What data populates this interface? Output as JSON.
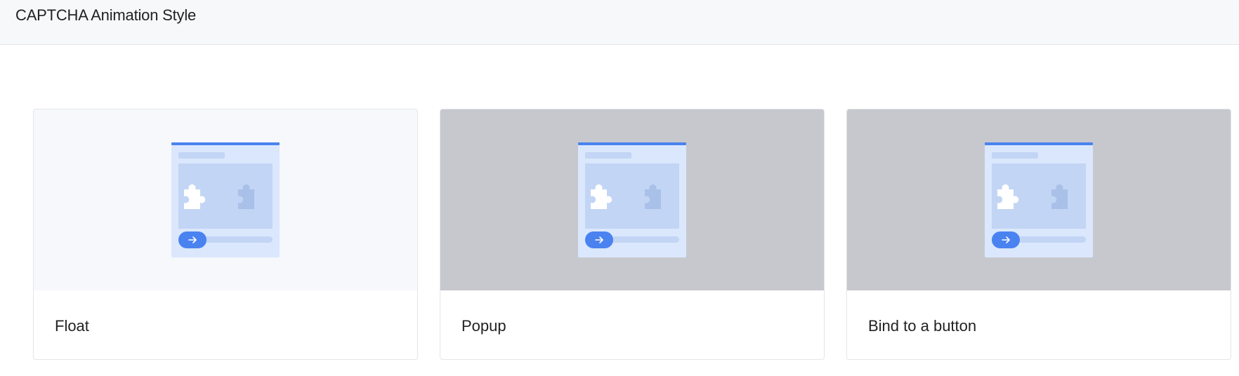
{
  "header": {
    "title": "CAPTCHA Animation Style"
  },
  "cards": [
    {
      "label": "Float",
      "preview_bg": "#f7f8fc"
    },
    {
      "label": "Popup",
      "preview_bg": "#c7c8cd"
    },
    {
      "label": "Bind to a button",
      "preview_bg": "#c7c8cd"
    }
  ],
  "illustration": {
    "accent": "#4a82f0",
    "panel": "#dbe7fc",
    "puzzle_area": "#c2d5f5",
    "piece_light": "#ffffff",
    "piece_shadow": "#a9c0e8",
    "icon": "arrow-right-icon"
  }
}
